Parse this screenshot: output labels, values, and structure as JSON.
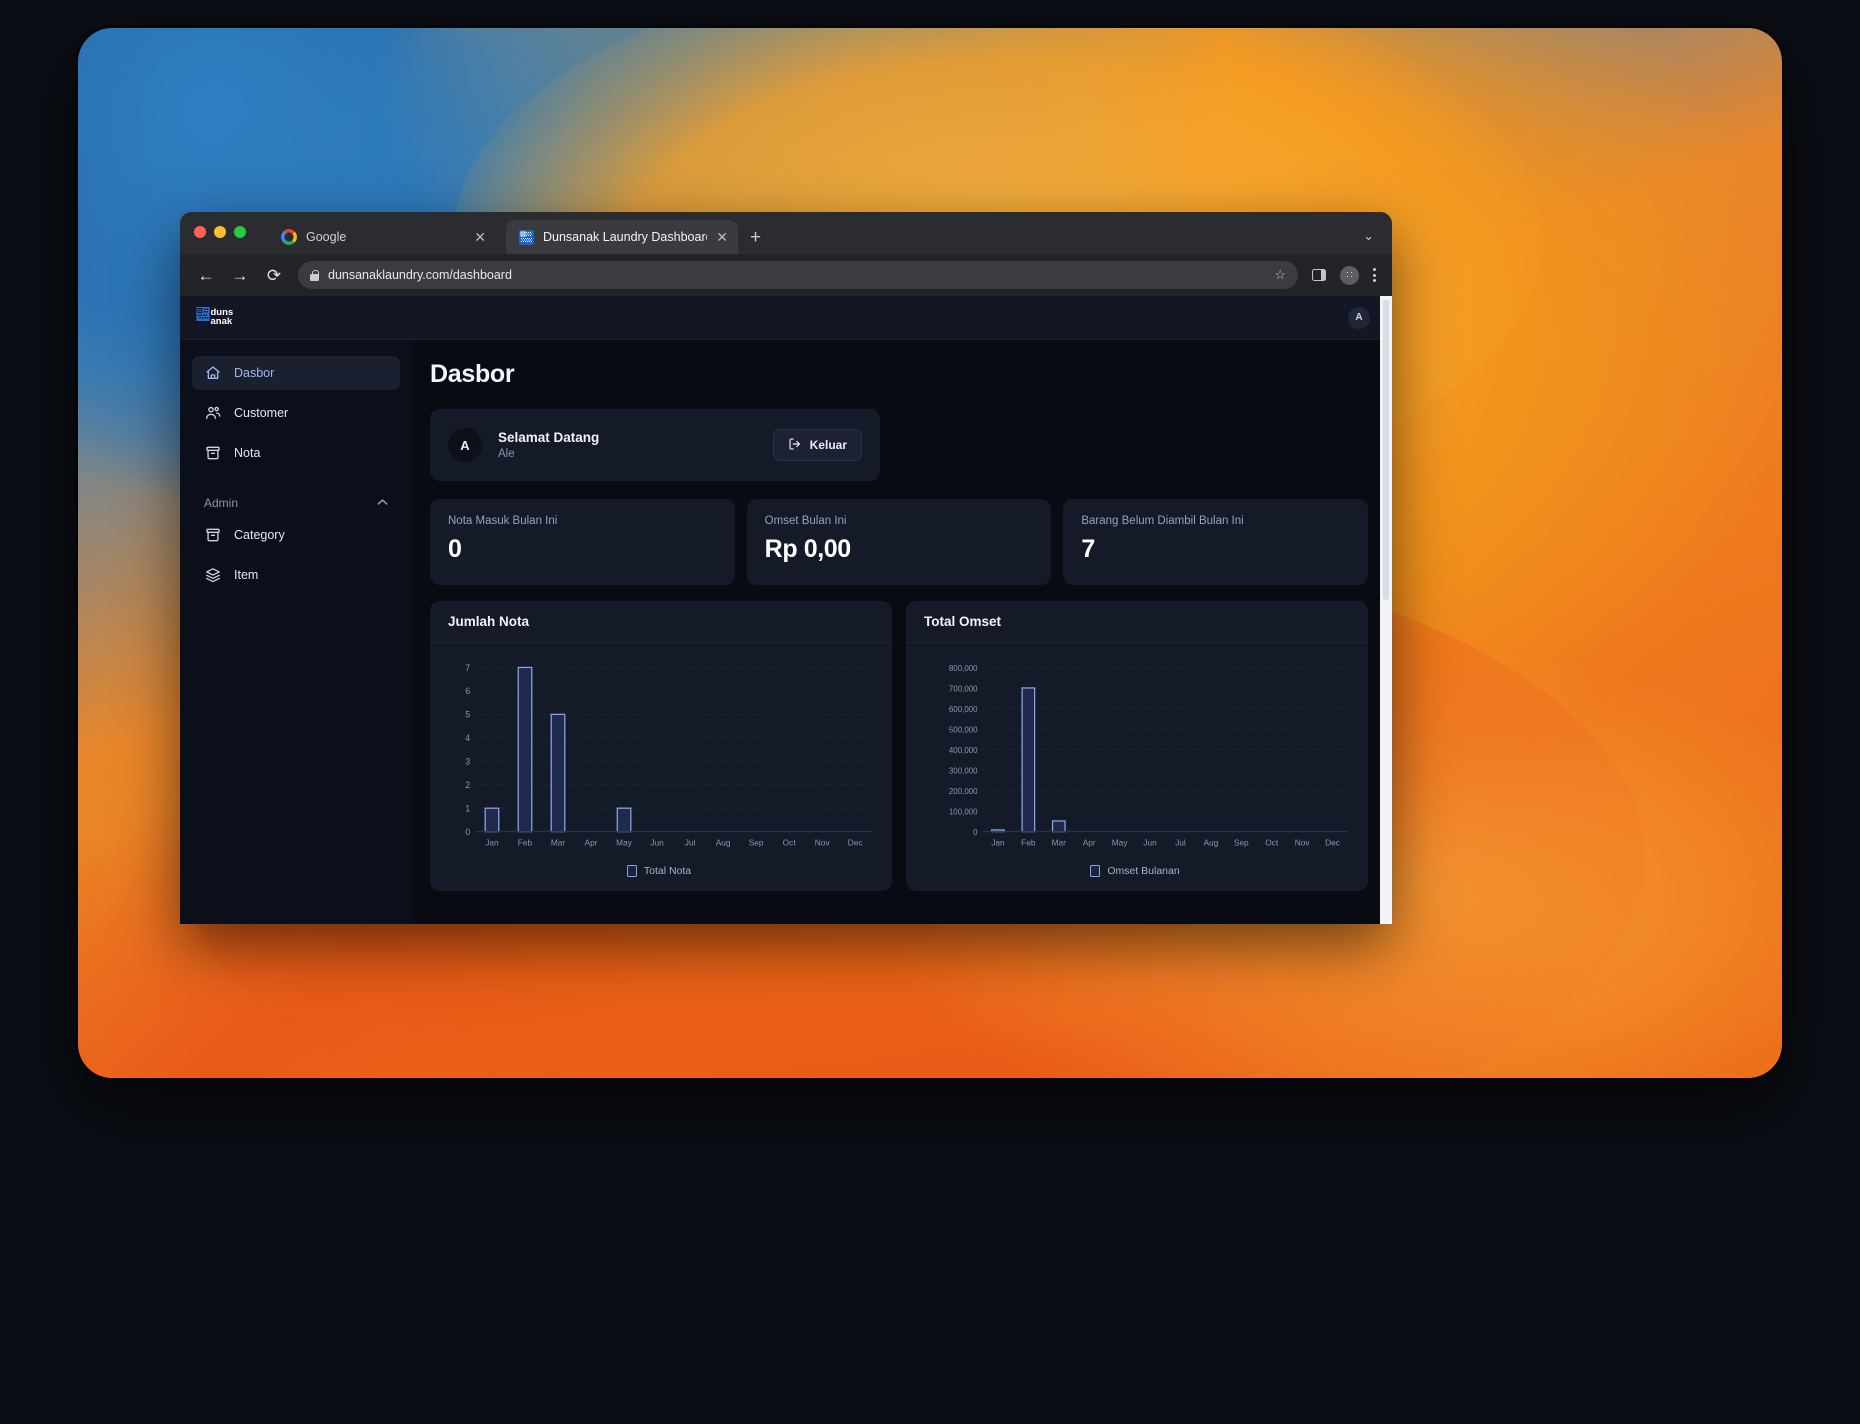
{
  "browser": {
    "tabs": [
      {
        "title": "Google",
        "icon": "google-icon",
        "active": false
      },
      {
        "title": "Dunsanak Laundry Dashboard",
        "icon": "site-favicon",
        "active": true
      }
    ],
    "new_tab_label": "+",
    "tab_list_chevron": "⌄",
    "back_label": "←",
    "forward_label": "→",
    "reload_label": "⟳",
    "url": "dunsanaklaundry.com/dashboard",
    "bookmark_label": "☆",
    "close_label": "✕",
    "profile_initial": "∷"
  },
  "app": {
    "brand": "dunsanak",
    "topbar_avatar": "A",
    "sidebar": {
      "items": [
        {
          "label": "Dasbor",
          "icon": "home-icon",
          "active": true
        },
        {
          "label": "Customer",
          "icon": "users-icon",
          "active": false
        },
        {
          "label": "Nota",
          "icon": "archive-icon",
          "active": false
        }
      ],
      "group_label": "Admin",
      "group_items": [
        {
          "label": "Category",
          "icon": "archive-icon",
          "active": false
        },
        {
          "label": "Item",
          "icon": "layers-icon",
          "active": false
        }
      ]
    },
    "page_title": "Dasbor",
    "welcome": {
      "avatar_initial": "A",
      "title": "Selamat Datang",
      "subtitle": "Ale",
      "logout_label": "Keluar"
    },
    "stats": [
      {
        "label": "Nota Masuk Bulan Ini",
        "value": "0"
      },
      {
        "label": "Omset Bulan Ini",
        "value": "Rp 0,00"
      },
      {
        "label": "Barang Belum Diambil Bulan Ini",
        "value": "7"
      }
    ],
    "colors": {
      "accent": "#8aa4e6",
      "bar_fill": "#1f2a4d",
      "bar_stroke": "#8aa4e6",
      "card_bg": "#151a28",
      "page_bg": "#080b12",
      "sidebar_bg": "#0b0f1a"
    }
  },
  "chart_data": [
    {
      "type": "bar",
      "title": "Jumlah Nota",
      "categories": [
        "Jan",
        "Feb",
        "Mar",
        "Apr",
        "May",
        "Jun",
        "Jul",
        "Aug",
        "Sep",
        "Oct",
        "Nov",
        "Dec"
      ],
      "series": [
        {
          "name": "Total Nota",
          "values": [
            1,
            7,
            5,
            0,
            1,
            0,
            0,
            0,
            0,
            0,
            0,
            0
          ]
        }
      ],
      "yticks": [
        0,
        1,
        2,
        3,
        4,
        5,
        6,
        7
      ],
      "ytick_labels": [
        "0",
        "1",
        "2",
        "3",
        "4",
        "5",
        "6",
        "7"
      ],
      "ylim": [
        0,
        7
      ],
      "xlabel": "",
      "ylabel": "",
      "grid": true,
      "legend_position": "bottom"
    },
    {
      "type": "bar",
      "title": "Total Omset",
      "categories": [
        "Jan",
        "Feb",
        "Mar",
        "Apr",
        "May",
        "Jun",
        "Jul",
        "Aug",
        "Sep",
        "Oct",
        "Nov",
        "Dec"
      ],
      "series": [
        {
          "name": "Omset Bulanan",
          "values": [
            8000,
            700000,
            52000,
            0,
            0,
            0,
            0,
            0,
            0,
            0,
            0,
            0
          ]
        }
      ],
      "yticks": [
        0,
        100000,
        200000,
        300000,
        400000,
        500000,
        600000,
        700000,
        800000
      ],
      "ytick_labels": [
        "0",
        "100,000",
        "200,000",
        "300,000",
        "400,000",
        "500,000",
        "600,000",
        "700,000",
        "800,000"
      ],
      "ylim": [
        0,
        800000
      ],
      "xlabel": "",
      "ylabel": "",
      "grid": true,
      "legend_position": "bottom"
    }
  ]
}
